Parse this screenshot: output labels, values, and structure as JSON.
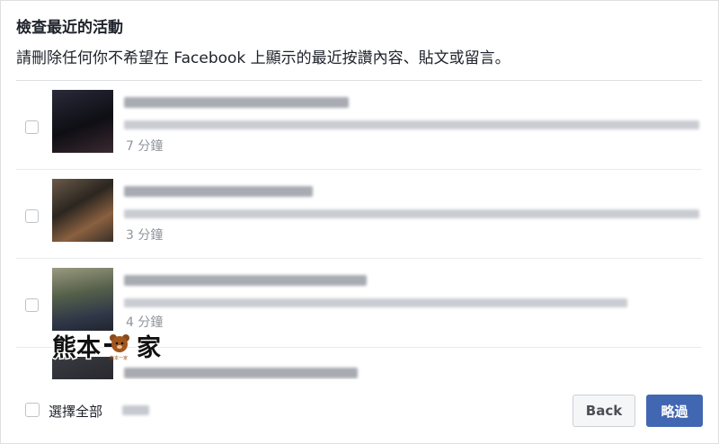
{
  "dialog": {
    "title": "檢查最近的活動",
    "subtitle": "請刪除任何你不希望在 Facebook 上顯示的最近按讚內容、貼文或留言。"
  },
  "activities": [
    {
      "time": "7 分鐘"
    },
    {
      "time": "3 分鐘"
    },
    {
      "time": "4 分鐘"
    }
  ],
  "footer": {
    "select_all_label": "選擇全部",
    "back_label": "Back",
    "skip_label": "略過"
  },
  "watermark": {
    "text": "熊本一家",
    "small_text": "熊本一家"
  },
  "colors": {
    "primary": "#4267b2",
    "border": "#dddfe2",
    "muted": "#90949c"
  }
}
